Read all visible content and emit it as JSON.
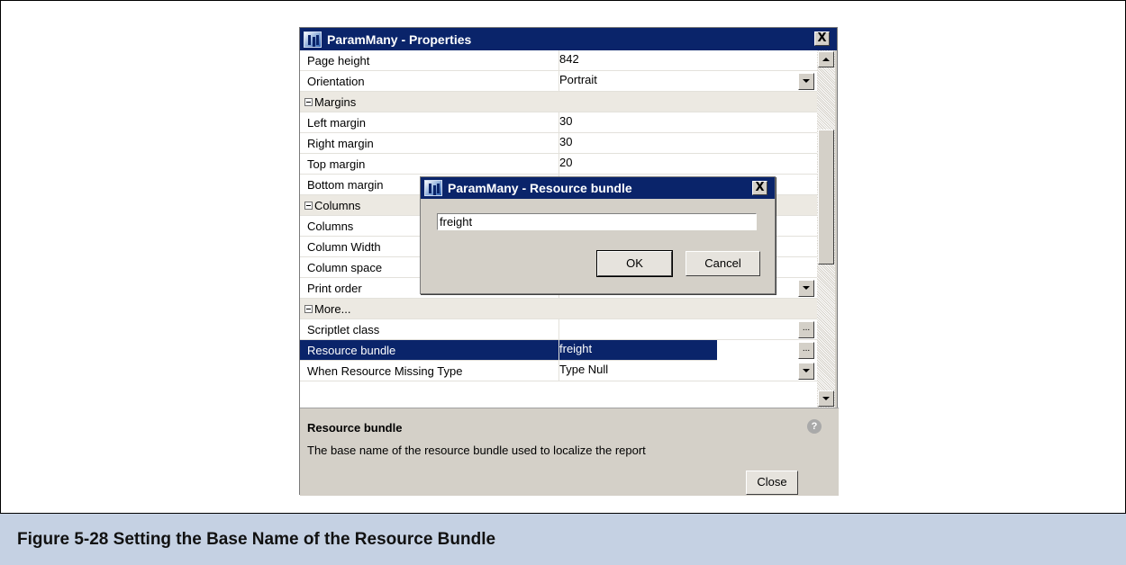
{
  "properties_window": {
    "title": "ParamMany - Properties",
    "close_glyph": "X",
    "rows": [
      {
        "name": "Page height",
        "value": "842",
        "type": "prop"
      },
      {
        "name": "Orientation",
        "value": "Portrait",
        "type": "prop",
        "control": "dropdown"
      },
      {
        "name": "Margins",
        "value": "",
        "type": "category"
      },
      {
        "name": "Left margin",
        "value": "30",
        "type": "prop"
      },
      {
        "name": "Right margin",
        "value": "30",
        "type": "prop"
      },
      {
        "name": "Top margin",
        "value": "20",
        "type": "prop"
      },
      {
        "name": "Bottom margin",
        "value": "",
        "type": "prop"
      },
      {
        "name": "Columns",
        "value": "",
        "type": "category"
      },
      {
        "name": "Columns",
        "value": "",
        "type": "prop"
      },
      {
        "name": "Column Width",
        "value": "",
        "type": "prop"
      },
      {
        "name": "Column space",
        "value": "",
        "type": "prop"
      },
      {
        "name": "Print order",
        "value": "",
        "type": "prop",
        "control": "dropdown"
      },
      {
        "name": "More...",
        "value": "",
        "type": "category"
      },
      {
        "name": "Scriptlet class",
        "value": "",
        "type": "prop",
        "control": "ellipsis"
      },
      {
        "name": "Resource bundle",
        "value": "freight",
        "type": "prop",
        "control": "ellipsis",
        "selected": true
      },
      {
        "name": "When Resource Missing Type",
        "value": "Type Null",
        "type": "prop",
        "control": "dropdown"
      }
    ],
    "ellipsis_label": "...",
    "description": {
      "title": "Resource bundle",
      "text": "The base name of the resource bundle used to localize the report",
      "help_glyph": "?"
    },
    "close_button_label": "Close"
  },
  "resource_dialog": {
    "title": "ParamMany - Resource bundle",
    "close_glyph": "X",
    "input_value": "freight",
    "ok_label": "OK",
    "cancel_label": "Cancel"
  },
  "caption": "Figure 5-28    Setting the Base Name of the Resource Bundle",
  "colors": {
    "titlebar": "#0a246a",
    "window_bg": "#d4d0c8",
    "caption_bg": "#c5d1e3",
    "selection": "#0a246a"
  }
}
